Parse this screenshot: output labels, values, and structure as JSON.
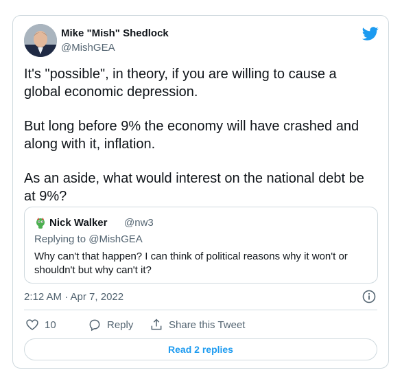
{
  "tweet": {
    "author_name": "Mike \"Mish\" Shedlock",
    "author_handle": "@MishGEA",
    "paragraphs": [
      "It's \"possible\", in theory, if you are willing to cause a global economic depression.",
      "But long before 9% the economy will have crashed and along with it, inflation.",
      "As an aside, what would interest on the national debt be at 9%?"
    ],
    "timestamp": "2:12 AM · Apr 7, 2022"
  },
  "quoted_tweet": {
    "author_name": "Nick Walker",
    "author_handle": "@nw3",
    "replying_to": "Replying to @MishGEA",
    "text": "Why can't that happen? I can think of political reasons why it won't or shouldn't but why can't it?"
  },
  "actions": {
    "like_count": "10",
    "reply_label": "Reply",
    "share_label": "Share this Tweet"
  },
  "replies_button": "Read 2 replies",
  "colors": {
    "accent": "#1d9bf0",
    "muted": "#536471",
    "border": "#cfd9de",
    "text": "#0f1419"
  },
  "icons": [
    "twitter-bird-icon",
    "info-icon",
    "heart-icon",
    "reply-icon",
    "share-icon"
  ]
}
